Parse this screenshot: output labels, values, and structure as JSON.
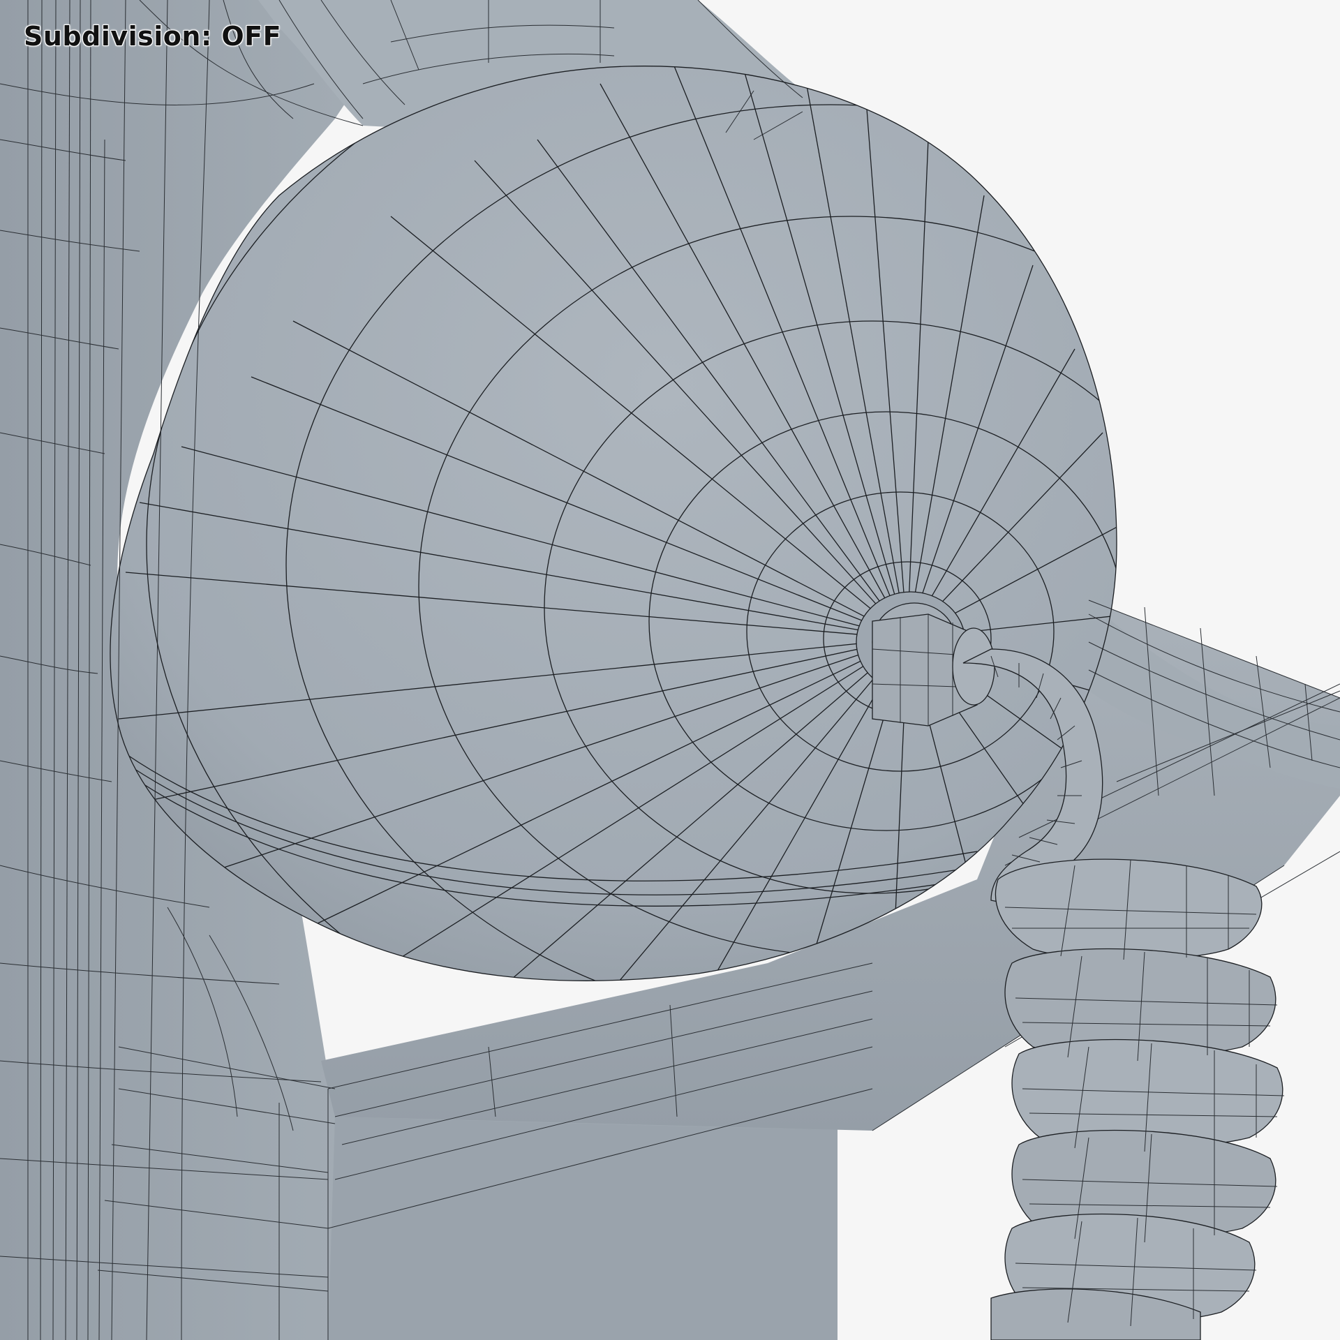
{
  "overlay": {
    "subdivision_label": "Subdivision: OFF"
  },
  "colors": {
    "background": "#f6f6f6",
    "mesh_light": "#a9b1b9",
    "mesh_mid": "#9aa3ac",
    "mesh_dark": "#838c96",
    "wire": "#1b1e22"
  }
}
